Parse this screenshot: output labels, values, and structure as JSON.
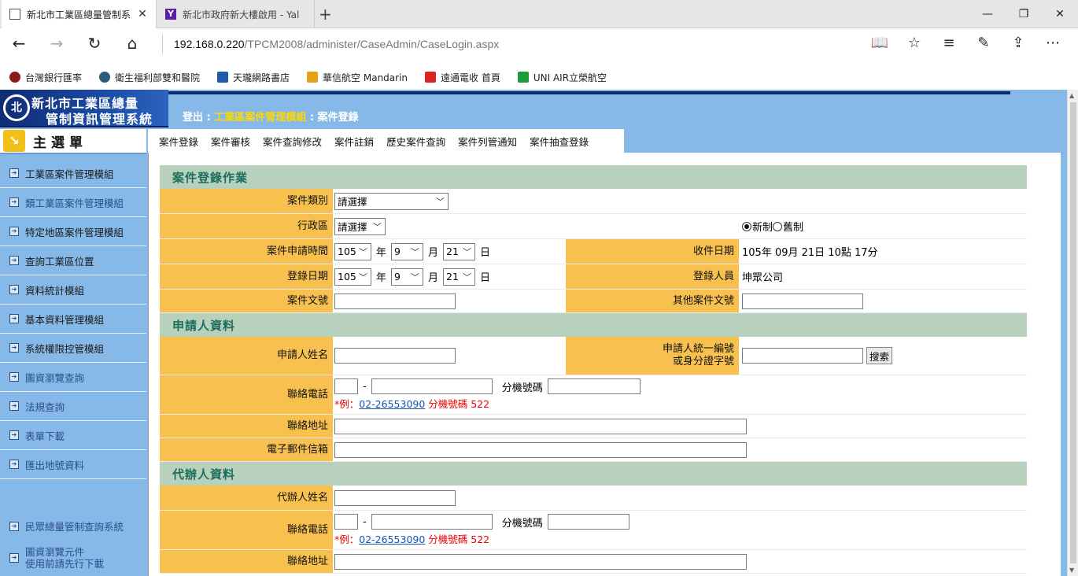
{
  "browser": {
    "tabs": [
      {
        "title": "新北市工業區總量管制系"
      },
      {
        "title": "新北市政府新大樓啟用 - Yal"
      }
    ],
    "url_host": "192.168.0.220",
    "url_path": "/TPCM2008/administer/CaseAdmin/CaseLogin.aspx",
    "favorites": [
      "台灣銀行匯率",
      "衛生福利部雙和醫院",
      "天瓏網路書店",
      "華信航空 Mandarin",
      "遠通電收 首頁",
      "UNI AIR立榮航空"
    ]
  },
  "header": {
    "logo_line1": "新北市工業區總量",
    "logo_line2": "管制資訊管理系統",
    "logout": "登出",
    "module": "工業區案件管理模組",
    "current": "案件登錄"
  },
  "menu": {
    "title": "主選單",
    "items": [
      "工業區案件管理模組",
      "類工業區案件管理模組",
      "特定地區案件管理模組",
      "查詢工業區位置",
      "資料統計模組",
      "基本資料管理模組",
      "系統權限控管模組",
      "圖資瀏覽查詢",
      "法規查詢",
      "表單下載",
      "匯出地號資料"
    ],
    "bottom": [
      "民眾總量管制查詢系統",
      "圖資瀏覽元件",
      "使用前請先行下載"
    ]
  },
  "tabs": [
    "案件登錄",
    "案件審核",
    "案件查詢修改",
    "案件註銷",
    "歷史案件查詢",
    "案件列管通知",
    "案件抽查登錄"
  ],
  "form": {
    "section1": "案件登錄作業",
    "case_type_label": "案件類別",
    "case_type_value": "請選擇",
    "district_label": "行政區",
    "district_value": "請選擇",
    "radio_new": "新制",
    "radio_old": "舊制",
    "apply_time_label": "案件申請時間",
    "apply_year": "105",
    "apply_month": "9",
    "apply_day": "21",
    "unit_year": "年",
    "unit_month": "月",
    "unit_day": "日",
    "receive_label": "收件日期",
    "receive_value": "105年 09月 21日 10點 17分",
    "login_date_label": "登錄日期",
    "login_year": "105",
    "login_month": "9",
    "login_day": "21",
    "login_person_label": "登錄人員",
    "login_person_value": "坤眾公司",
    "doc_no_label": "案件文號",
    "other_doc_label": "其他案件文號",
    "section2": "申請人資料",
    "applicant_name_label": "申請人姓名",
    "applicant_id_label1": "申請人統一編號",
    "applicant_id_label2": "或身分證字號",
    "search_button": "搜索",
    "phone_label": "聯絡電話",
    "dash": "-",
    "ext_label": "分機號碼",
    "hint_prefix": "*例：",
    "hint_phone": "02-26553090",
    "hint_ext": "分機號碼 522",
    "address_label": "聯絡地址",
    "email_label": "電子郵件信箱",
    "section3": "代辦人資料",
    "agent_name_label": "代辦人姓名",
    "agent_phone_label": "聯絡電話",
    "agent_address_label": "聯絡地址"
  },
  "colors": {
    "page_bg": "#86b9e7",
    "label_bg": "#f8c14f",
    "section_bg": "#b8d1bd",
    "section_text": "#1a6e5b"
  }
}
